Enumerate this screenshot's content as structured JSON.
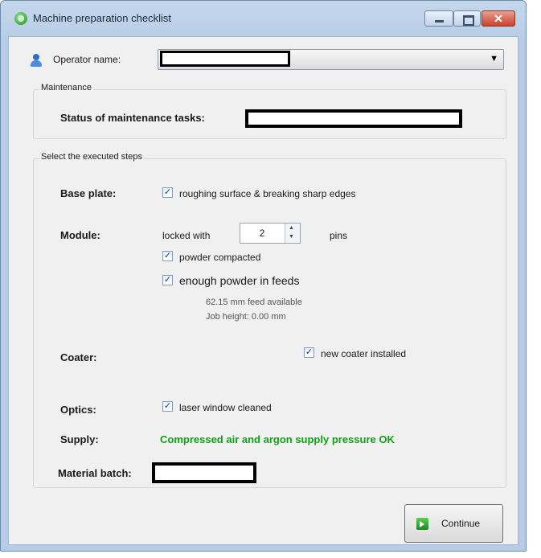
{
  "window": {
    "title": "Machine preparation checklist",
    "close_label": "✕"
  },
  "operator": {
    "label": "Operator name:"
  },
  "maintenance": {
    "group_title": "Maintenance",
    "status_label": "Status of maintenance tasks:"
  },
  "steps": {
    "group_title": "Select the executed steps",
    "base_plate": {
      "label": "Base plate:",
      "check_label": "roughing surface & breaking sharp edges",
      "checked": true
    },
    "module": {
      "label": "Module:",
      "locked_prefix": "locked with",
      "pins_value": "2",
      "pins_suffix": "pins",
      "powder_compacted_label": "powder compacted",
      "enough_powder_label": "enough powder in feeds",
      "feed_available": "62.15 mm feed available",
      "job_height": "Job height: 0.00 mm"
    },
    "coater": {
      "label": "Coater:",
      "check_label": "new coater installed"
    },
    "optics": {
      "label": "Optics:",
      "check_label": "laser window cleaned"
    },
    "supply": {
      "label": "Supply:",
      "status": "Compressed air and argon supply pressure OK",
      "status_color": "#12a017"
    },
    "material_batch": {
      "label": "Material batch:"
    }
  },
  "buttons": {
    "continue_label": "Continue"
  },
  "check_mark": "✓",
  "icons": {
    "app": "green-circle-icon",
    "operator": "user-icon",
    "continue": "green-arrow-icon",
    "combo_arrow": "chevron-down-icon"
  }
}
